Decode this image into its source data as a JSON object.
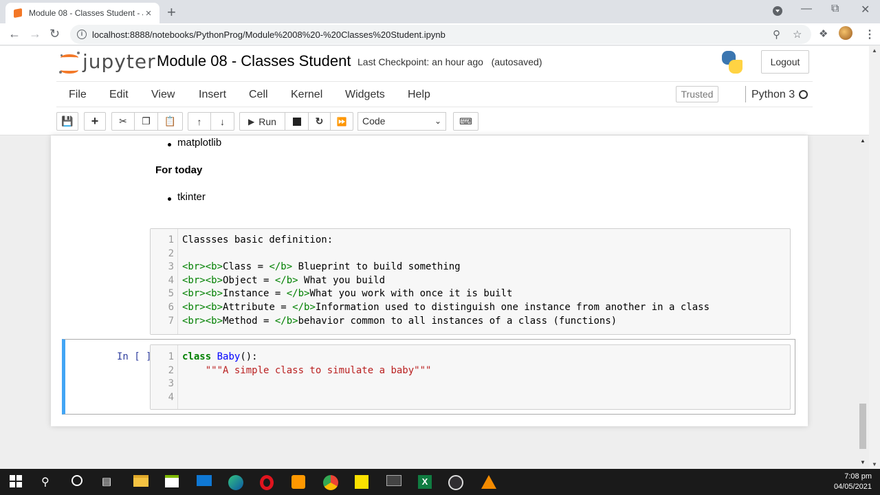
{
  "browser": {
    "tab_title": "Module 08 - Classes Student - Ju",
    "tab_close": "×",
    "new_tab": "+",
    "url": "localhost:8888/notebooks/PythonProg/Module%2008%20-%20Classes%20Student.ipynb"
  },
  "jupyter": {
    "logo_text": "jupyter",
    "notebook_title": "Module 08 - Classes Student",
    "checkpoint": "Last Checkpoint: an hour ago",
    "autosaved": "(autosaved)",
    "logout": "Logout",
    "menu": [
      "File",
      "Edit",
      "View",
      "Insert",
      "Cell",
      "Kernel",
      "Widgets",
      "Help"
    ],
    "trusted": "Trusted",
    "kernel": "Python 3",
    "run_label": "Run",
    "cell_type": "Code"
  },
  "markdown": {
    "bullet_top": "matplotlib",
    "heading": "For today",
    "bullet_today": "tkinter"
  },
  "code_cell_1": {
    "line_numbers": [
      "1",
      "2",
      "3",
      "4",
      "5",
      "6",
      "7"
    ],
    "lines": [
      {
        "plain": "Classses basic definition:"
      },
      {
        "plain": ""
      },
      {
        "tag1": "<br><b>",
        "label": "Class = ",
        "tag2": "</b>",
        "text": " Blueprint to build something"
      },
      {
        "tag1": "<br><b>",
        "label": "Object = ",
        "tag2": "</b>",
        "text": " What you build"
      },
      {
        "tag1": "<br><b>",
        "label": "Instance = ",
        "tag2": "</b>",
        "text": "What you work with once it is built"
      },
      {
        "tag1": "<br><b>",
        "label": "Attribute = ",
        "tag2": "</b>",
        "text": "Information used to distinguish one instance from another in a class"
      },
      {
        "tag1": "<br><b>",
        "label": "Method = ",
        "tag2": "</b>",
        "text": "behavior common to all instances of a class (functions)"
      }
    ]
  },
  "code_cell_2": {
    "prompt": "In [ ]:",
    "line_numbers": [
      "1",
      "2",
      "3",
      "4"
    ],
    "keyword": "class",
    "class_name": "Baby",
    "class_tail": "():",
    "docstring": "\"\"\"A simple class to simulate a baby\"\"\""
  },
  "taskbar": {
    "time": "7:08 pm",
    "date": "04/05/2021"
  }
}
